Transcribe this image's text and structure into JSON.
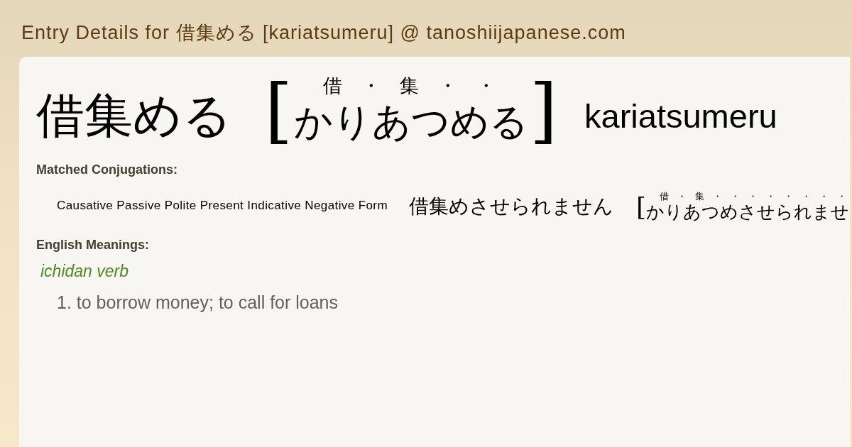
{
  "page_title": "Entry Details for 借集める [kariatsumeru] @ tanoshiijapanese.com",
  "entry": {
    "word": "借集める",
    "brackets": [
      "[",
      "]"
    ],
    "reading": "かりあつめる",
    "reading_marks": [
      "借",
      "・",
      "集",
      "・",
      "・"
    ],
    "romaji": "kariatsumeru"
  },
  "matched_conjugations": {
    "heading": "Matched Conjugations:",
    "items": [
      {
        "form": "Causative Passive Polite Present Indicative Negative Form",
        "word": "借集めさせられません",
        "bracket": "[",
        "reading": "かりあつめさせられませ",
        "reading_marks": [
          "借",
          "・",
          "集",
          "・",
          "・",
          "・",
          "・",
          "・",
          "・",
          "・",
          "・"
        ]
      }
    ]
  },
  "english_meanings": {
    "heading": "English Meanings:",
    "groups": [
      {
        "part_of_speech": "ichidan verb",
        "meanings": [
          "1. to borrow money; to call for loans"
        ]
      }
    ]
  }
}
